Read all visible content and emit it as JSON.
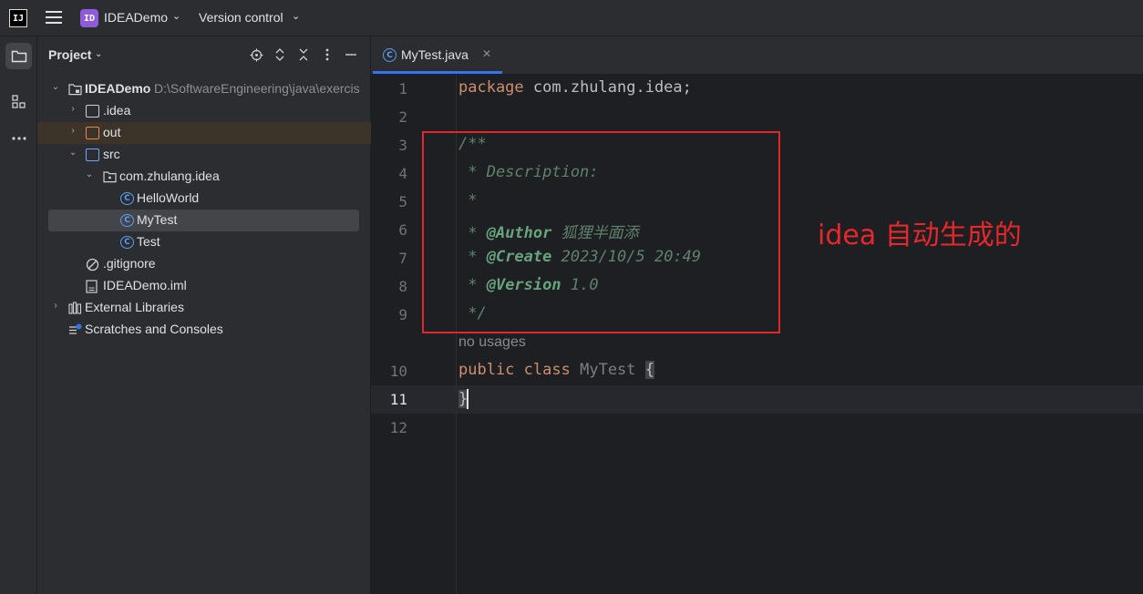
{
  "titlebar": {
    "logo_text": "IJ",
    "project_badge": "ID",
    "project_name": "IDEADemo",
    "vcs_label": "Version control"
  },
  "toolstrip": {
    "items": [
      "project-folder-icon",
      "structure-icon",
      "more-icon"
    ]
  },
  "project_panel": {
    "title": "Project",
    "tree": [
      {
        "label": "IDEADemo",
        "path": "D:\\SoftwareEngineering\\java\\exercis",
        "type": "module"
      },
      {
        "label": ".idea",
        "type": "folder"
      },
      {
        "label": "out",
        "type": "folder-excluded"
      },
      {
        "label": "src",
        "type": "folder-source"
      },
      {
        "label": "com.zhulang.idea",
        "type": "package"
      },
      {
        "label": "HelloWorld",
        "type": "class"
      },
      {
        "label": "MyTest",
        "type": "class",
        "selected": true
      },
      {
        "label": "Test",
        "type": "class"
      },
      {
        "label": ".gitignore",
        "type": "ignore-file"
      },
      {
        "label": "IDEADemo.iml",
        "type": "iml-file"
      },
      {
        "label": "External Libraries",
        "type": "libraries"
      },
      {
        "label": "Scratches and Consoles",
        "type": "scratches"
      }
    ]
  },
  "editor": {
    "tab_label": "MyTest.java",
    "line_numbers": [
      "1",
      "2",
      "3",
      "4",
      "5",
      "6",
      "7",
      "8",
      "9",
      "10",
      "11",
      "12"
    ],
    "current_line": "11",
    "code": {
      "l1_kw": "package",
      "l1_rest": " com.zhulang.idea;",
      "l3": "/**",
      "l4": " * Description:",
      "l5": " *",
      "l6_star": " * ",
      "l6_tag": "@Author",
      "l6_val": " 狐狸半面添",
      "l7_star": " * ",
      "l7_tag": "@Create",
      "l7_val": " 2023/10/5 20:49",
      "l8_star": " * ",
      "l8_tag": "@Version",
      "l8_val": " 1.0",
      "l9": " */",
      "usages_hint": "no usages",
      "l10_kw1": "public",
      "l10_kw2": "class",
      "l10_name": "MyTest",
      "l10_brace": "{",
      "l11_brace": "}"
    }
  },
  "annotation": {
    "text": "idea 自动生成的",
    "color": "#e4282b"
  },
  "colors": {
    "accent": "#3574f0",
    "keyword": "#cf8e6d",
    "doc_comment": "#5f826b",
    "class_icon": "#5c9df5"
  }
}
